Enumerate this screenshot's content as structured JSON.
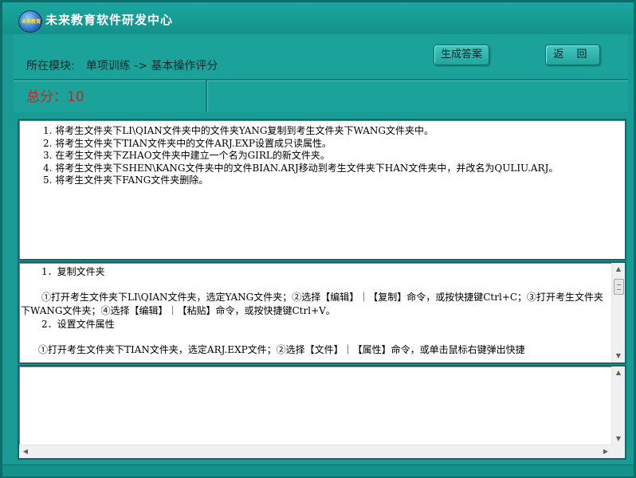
{
  "app": {
    "title": "未来教育软件研发中心",
    "logo_text": "未来教育"
  },
  "header": {
    "module_label": "所在模块:",
    "module_path": "单项训练 -> 基本操作评分",
    "generate_answer_label": "生成答案",
    "back_label": "返 回",
    "score_text": "总分：10"
  },
  "questions": [
    "1. 将考生文件夹下LI\\QIAN文件夹中的文件夹YANG复制到考生文件夹下WANG文件夹中。",
    "2. 将考生文件夹下TIAN文件夹中的文件ARJ.EXP设置成只读属性。",
    "3. 在考生文件夹下ZHAO文件夹中建立一个名为GIRL的新文件夹。",
    "4. 将考生文件夹下SHEN\\KANG文件夹中的文件BIAN.ARJ移动到考生文件夹下HAN文件夹中，并改名为QULIU.ARJ。",
    "5. 将考生文件夹下FANG文件夹删除。"
  ],
  "answers": {
    "heading1": "1．复制文件夹",
    "step1": "①打开考生文件夹下LI\\QIAN文件夹，选定YANG文件夹；②选择【编辑】｜【复制】命令，或按快捷键Ctrl+C；③打开考生文件夹下WANG文件夹；④选择【编辑】｜【粘贴】命令，或按快捷键Ctrl+V。",
    "heading2": "2．设置文件属性",
    "step2": "①打开考生文件夹下TIAN文件夹，选定ARJ.EXP文件；②选择【文件】｜【属性】命令，或单击鼠标右键弹出快捷"
  },
  "colors": {
    "background": "#1a9a94",
    "score": "#d81f1f"
  }
}
